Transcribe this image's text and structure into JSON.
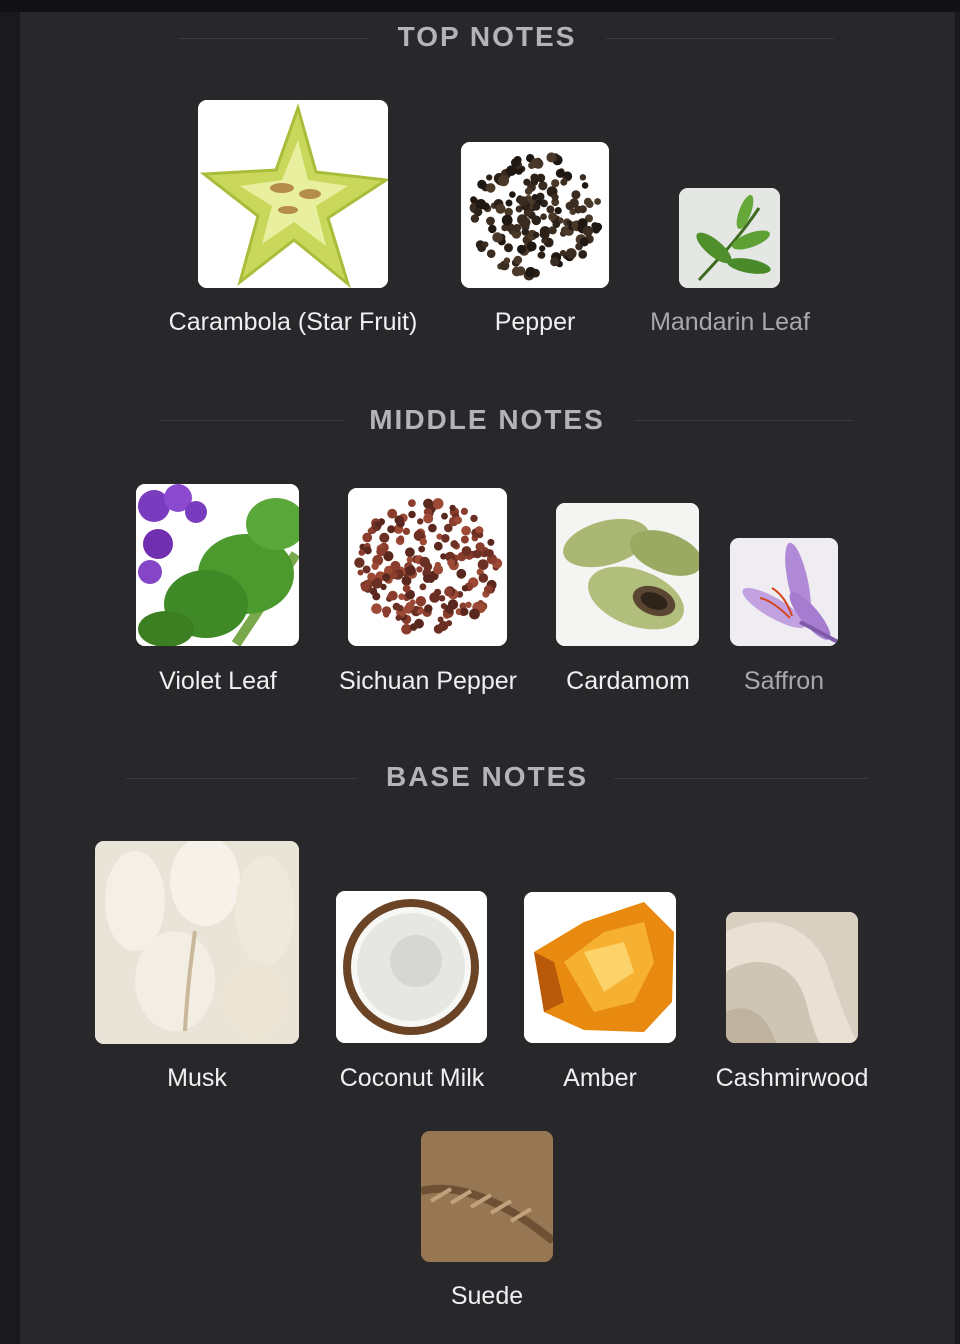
{
  "sections": {
    "top": {
      "title": "TOP NOTES",
      "notes": [
        {
          "label": "Carambola (Star Fruit)",
          "icon": "star-fruit-icon"
        },
        {
          "label": "Pepper",
          "icon": "pepper-icon"
        },
        {
          "label": "Mandarin Leaf",
          "icon": "mandarin-leaf-icon"
        }
      ]
    },
    "middle": {
      "title": "MIDDLE NOTES",
      "notes": [
        {
          "label": "Violet Leaf",
          "icon": "violet-leaf-icon"
        },
        {
          "label": "Sichuan Pepper",
          "icon": "sichuan-pepper-icon"
        },
        {
          "label": "Cardamom",
          "icon": "cardamom-icon"
        },
        {
          "label": "Saffron",
          "icon": "saffron-icon"
        }
      ]
    },
    "base": {
      "title": "BASE NOTES",
      "notes": [
        {
          "label": "Musk",
          "icon": "musk-icon"
        },
        {
          "label": "Coconut Milk",
          "icon": "coconut-icon"
        },
        {
          "label": "Amber",
          "icon": "amber-icon"
        },
        {
          "label": "Cashmirwood",
          "icon": "cashmirwood-icon"
        },
        {
          "label": "Suede",
          "icon": "suede-icon"
        }
      ]
    }
  }
}
